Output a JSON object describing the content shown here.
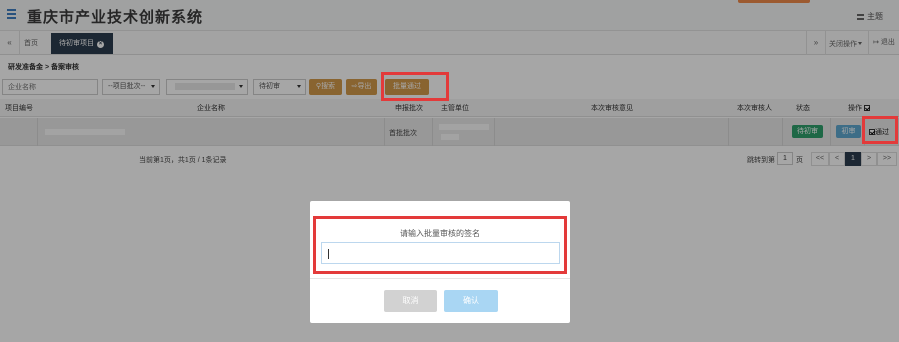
{
  "header": {
    "title": "重庆市产业技术创新系统",
    "theme_label": "主题"
  },
  "tabs": {
    "home": "首页",
    "active": "待初审项目",
    "close_ops": "关闭操作",
    "logout": "退出"
  },
  "breadcrumb": "研发准备金 > 备案审核",
  "filters": {
    "company_placeholder": "企业名称",
    "batch_select": "--项目批次--",
    "status_select": "待初审",
    "search_label": "搜索",
    "export_label": "导出",
    "batch_pass_label": "批量通过"
  },
  "table": {
    "columns": [
      "项目编号",
      "企业名称",
      "申报批次",
      "主管单位",
      "本次审核意见",
      "本次审核人",
      "状态",
      "操作"
    ],
    "row": {
      "batch": "首批批次",
      "status": "待初审",
      "review": "初审",
      "pass": "通过"
    }
  },
  "pagination": {
    "summary": "当前第1页，共1页 / 1条记录",
    "jump_label": "跳转到第",
    "jump_value": "1",
    "page_unit": "页",
    "first": "<<",
    "prev": "<",
    "current": "1",
    "next": ">",
    "last": ">>"
  },
  "modal": {
    "title": "请输入批量审核的签名",
    "input_value": "",
    "cancel_label": "取消",
    "confirm_label": "确认"
  },
  "colors": {
    "accent_dark": "#2c3d4f",
    "orange": "#d39a4a",
    "status_green": "#2ea06c",
    "review_blue": "#5fa8cf",
    "annotation_red": "#e33a3a"
  }
}
